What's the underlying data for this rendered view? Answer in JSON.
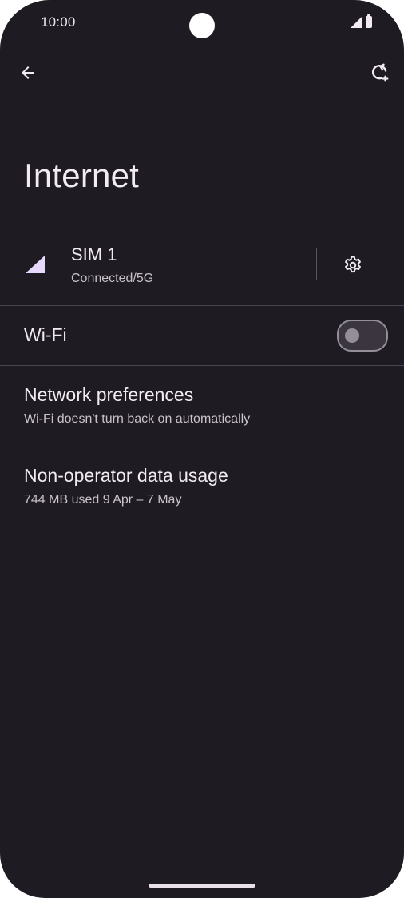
{
  "status_bar": {
    "time": "10:00",
    "icons": [
      "signal-icon",
      "battery-icon"
    ]
  },
  "app_bar": {
    "back_icon": "arrow-back-icon",
    "refresh_icon": "refresh-icon"
  },
  "page": {
    "title": "Internet"
  },
  "sim": {
    "name": "SIM 1",
    "status": "Connected/5G",
    "signal_icon": "cellular-signal-icon",
    "settings_icon": "gear-icon",
    "signal_color": "#e6d9fb"
  },
  "wifi": {
    "label": "Wi-Fi",
    "enabled": false
  },
  "items": [
    {
      "title": "Network preferences",
      "subtitle": "Wi-Fi doesn't turn back on automatically"
    },
    {
      "title": "Non-operator data usage",
      "subtitle": "744 MB used 9 Apr – 7 May"
    }
  ],
  "colors": {
    "background": "#1f1b22",
    "text_primary": "#f2ecf2",
    "text_secondary": "#c9c1cb",
    "accent": "#e6d9fb"
  }
}
